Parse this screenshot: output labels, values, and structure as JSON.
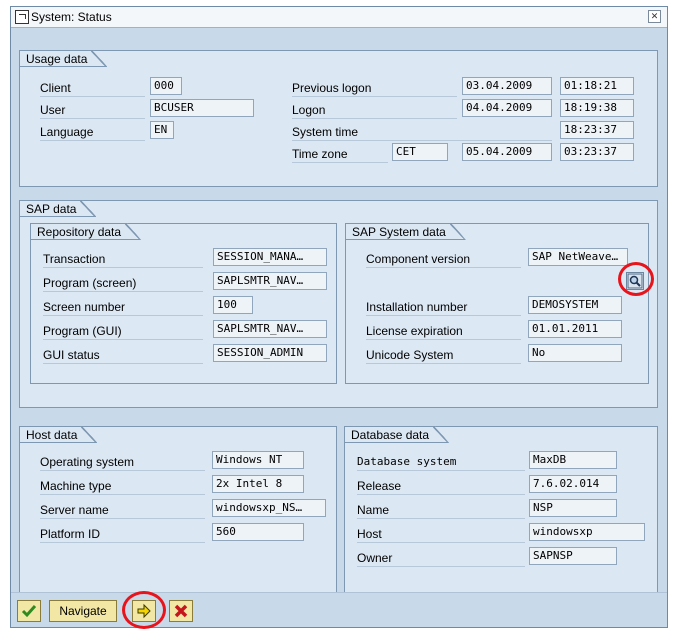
{
  "window": {
    "title": "System: Status"
  },
  "usage": {
    "tab": "Usage data",
    "client_label": "Client",
    "client": "000",
    "user_label": "User",
    "user": "BCUSER",
    "language_label": "Language",
    "language": "EN",
    "prev_logon_label": "Previous logon",
    "prev_logon_date": "03.04.2009",
    "prev_logon_time": "01:18:21",
    "logon_label": "Logon",
    "logon_date": "04.04.2009",
    "logon_time": "18:19:38",
    "system_time_label": "System time",
    "system_time": "18:23:37",
    "time_zone_label": "Time zone",
    "time_zone": "CET",
    "tz_date": "05.04.2009",
    "tz_time": "03:23:37"
  },
  "sap": {
    "tab": "SAP data",
    "repo": {
      "tab": "Repository data",
      "transaction_label": "Transaction",
      "transaction": "SESSION_MANA…",
      "program_screen_label": "Program (screen)",
      "program_screen": "SAPLSMTR_NAV…",
      "screen_number_label": "Screen number",
      "screen_number": "100",
      "program_gui_label": "Program (GUI)",
      "program_gui": "SAPLSMTR_NAV…",
      "gui_status_label": "GUI status",
      "gui_status": "SESSION_ADMIN"
    },
    "system": {
      "tab": "SAP System data",
      "component_label": "Component version",
      "component": "SAP NetWeave…",
      "installation_label": "Installation number",
      "installation": "DEMOSYSTEM",
      "license_label": "License expiration",
      "license": "01.01.2011",
      "unicode_label": "Unicode System",
      "unicode": "No"
    }
  },
  "host": {
    "tab": "Host data",
    "os_label": "Operating system",
    "os": "Windows NT",
    "machine_label": "Machine type",
    "machine": "2x Intel 8",
    "server_label": "Server name",
    "server": "windowsxp_NS…",
    "platform_label": "Platform ID",
    "platform": "560"
  },
  "db": {
    "tab": "Database data",
    "system_label": "Database system",
    "system": "MaxDB",
    "release_label": "Release",
    "release": "7.6.02.014",
    "name_label": "Name",
    "name": "NSP",
    "host_label": "Host",
    "host": "windowsxp",
    "owner_label": "Owner",
    "owner": "SAPNSP"
  },
  "toolbar": {
    "navigate_label": "Navigate"
  },
  "colors": {
    "highlight": "#e8141b",
    "button": "#f2e7a4"
  }
}
